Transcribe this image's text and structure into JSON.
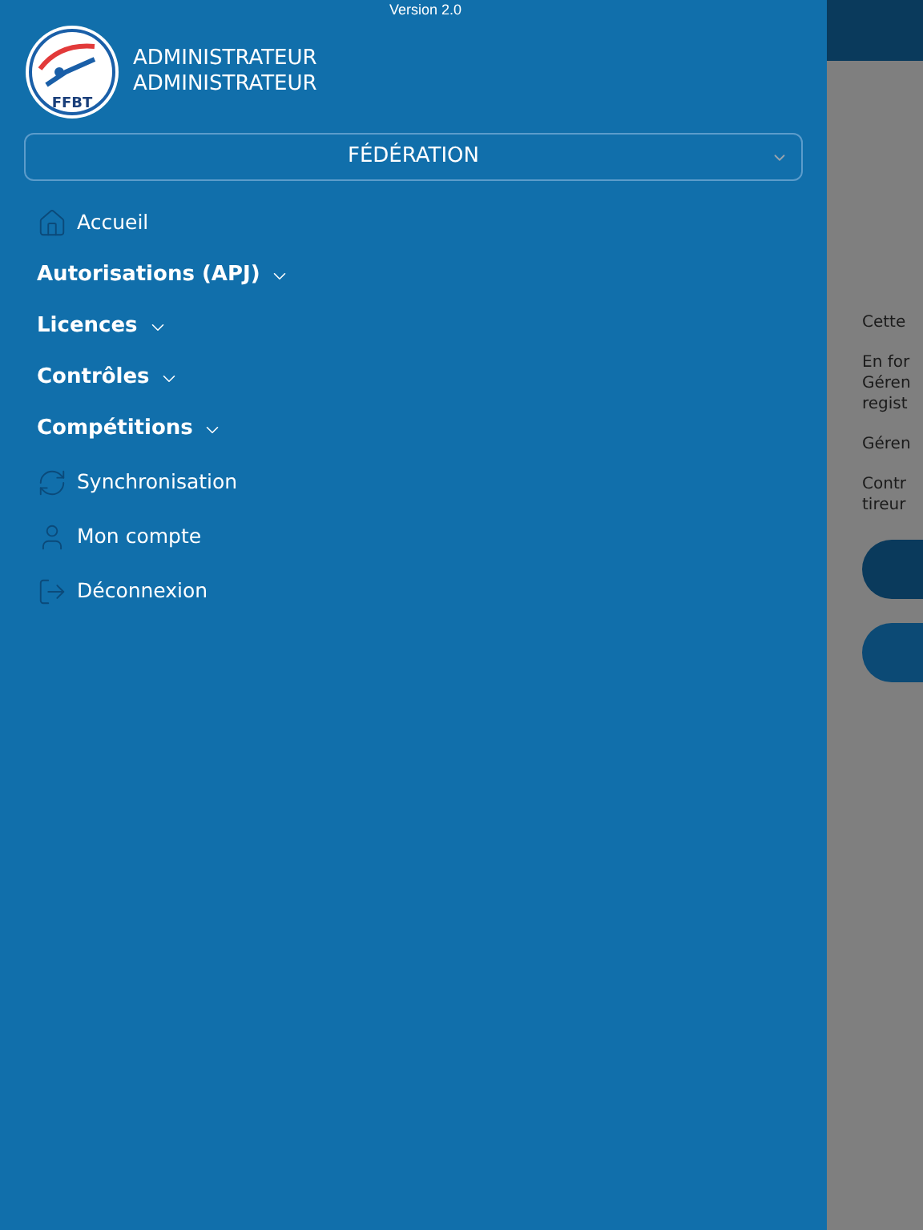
{
  "version": "Version 2.0",
  "logo": {
    "text": "FFBT"
  },
  "user": {
    "first_name": "ADMINISTRATEUR",
    "last_name": "ADMINISTRATEUR"
  },
  "profile_select": {
    "value": "FÉDÉRATION"
  },
  "menu": [
    {
      "kind": "home",
      "label": "Accueil"
    },
    {
      "kind": "group",
      "label": "Autorisations (APJ)",
      "expanded": false
    },
    {
      "kind": "group",
      "label": "Licences",
      "expanded": false
    },
    {
      "kind": "group",
      "label": "Contrôles",
      "expanded": false
    },
    {
      "kind": "group",
      "label": "Compétitions",
      "expanded": false
    },
    {
      "kind": "sync",
      "label": "Synchronisation"
    },
    {
      "kind": "account",
      "label": "Mon compte"
    },
    {
      "kind": "logout",
      "label": "Déconnexion"
    }
  ],
  "background_page": {
    "paragraphs": [
      [
        "Cette"
      ],
      [
        "En for",
        "Géren",
        "regist"
      ],
      [
        "Géren"
      ],
      [
        "Contr",
        "tireur"
      ]
    ],
    "buttons": [
      {
        "kind": "primary"
      },
      {
        "kind": "secondary"
      }
    ]
  }
}
